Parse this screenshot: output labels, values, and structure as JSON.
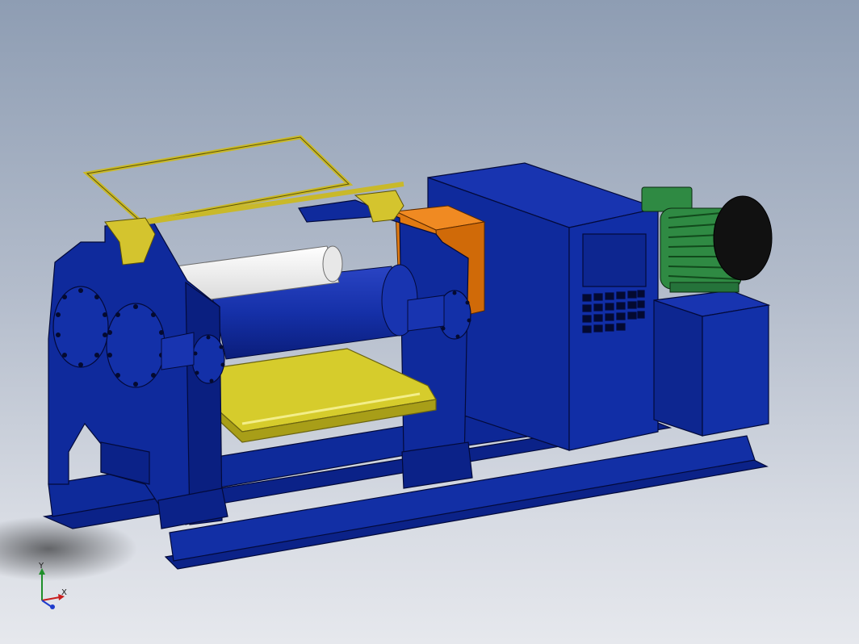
{
  "viewport": {
    "background_top": "#8e9db3",
    "background_bottom": "#e6e8ed"
  },
  "model": {
    "colors": {
      "frame": "#0f2a9c",
      "frame_dark": "#081a6e",
      "frame_edge": "#030a3a",
      "roller_light": "#f2f2f2",
      "tray": "#d6cc2c",
      "guard": "#c9b92a",
      "coupling": "#e07a12",
      "motor": "#2f8a43",
      "motor_cap": "#111111"
    }
  },
  "triad": {
    "y_label": "Y",
    "x_label": "X",
    "y_color": "#1f8f2a",
    "x_color": "#c81e1e",
    "z_color": "#1f3ccc"
  }
}
